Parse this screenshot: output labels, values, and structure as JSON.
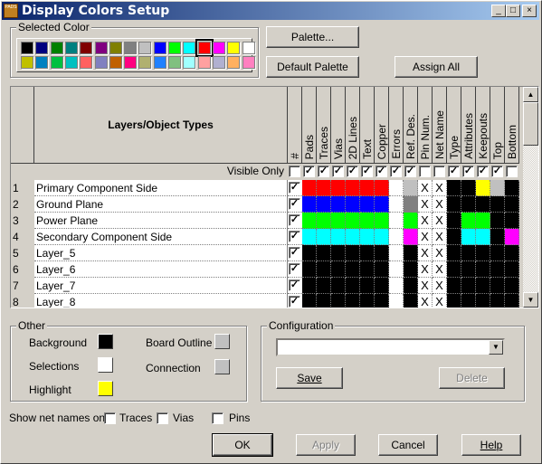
{
  "window": {
    "title": "Display Colors Setup",
    "app_icon_text": "PADS",
    "controls": [
      "_",
      "□",
      "×"
    ]
  },
  "selected_color": {
    "label": "Selected Color",
    "selected_index": 12,
    "palette": [
      "#000000",
      "#000080",
      "#008000",
      "#008080",
      "#800000",
      "#800080",
      "#808000",
      "#808080",
      "#c0c0c0",
      "#0000ff",
      "#00ff00",
      "#00ffff",
      "#ff0000",
      "#ff00ff",
      "#ffff00",
      "#ffffff",
      "#c0c000",
      "#0080c0",
      "#00c040",
      "#00c0c0",
      "#ff6060",
      "#8080c0",
      "#c06000",
      "#ff0080",
      "#b0b070",
      "#2080ff",
      "#80c080",
      "#a0ffff",
      "#ffa0a0",
      "#b0b0d0",
      "#ffb060",
      "#ff80c0"
    ]
  },
  "buttons": {
    "palette": "Palette...",
    "default_palette": "Default Palette",
    "assign_all": "Assign All",
    "save": "Save",
    "delete": "Delete",
    "ok": "OK",
    "apply": "Apply",
    "cancel": "Cancel",
    "help": "Help"
  },
  "table": {
    "header": "Layers/Object Types",
    "hash": "#",
    "visible_only": "Visible Only",
    "columns": [
      "Pads",
      "Traces",
      "Vias",
      "2D Lines",
      "Text",
      "Copper",
      "Errors",
      "Ref. Des.",
      "Pin Num.",
      "Net Name",
      "Type",
      "Attributes",
      "Keepouts",
      "Top",
      "Bottom"
    ],
    "visible_only_checks": [
      false,
      true,
      true,
      true,
      true,
      true,
      true,
      true,
      true,
      false,
      false,
      true,
      true,
      true,
      true,
      false
    ],
    "rows": [
      {
        "num": "1",
        "name": "Primary Component Side",
        "checked": true,
        "cells": [
          "#ff0000",
          "#ff0000",
          "#ff0000",
          "#ff0000",
          "#ff0000",
          "#ff0000",
          "#ffffff",
          "#c0c0c0",
          "X",
          "X",
          "#000000",
          "#000000",
          "#ffff00",
          "#c0c0c0",
          "#000000"
        ]
      },
      {
        "num": "2",
        "name": "Ground Plane",
        "checked": true,
        "cells": [
          "#0000ff",
          "#0000ff",
          "#0000ff",
          "#0000ff",
          "#0000ff",
          "#0000ff",
          "#ffffff",
          "#808080",
          "X",
          "X",
          "#000000",
          "#000000",
          "#000000",
          "#000000",
          "#000000"
        ]
      },
      {
        "num": "3",
        "name": "Power Plane",
        "checked": true,
        "cells": [
          "#00ff00",
          "#00ff00",
          "#00ff00",
          "#00ff00",
          "#00ff00",
          "#00ff00",
          "#ffffff",
          "#00ff00",
          "X",
          "X",
          "#000000",
          "#00ff00",
          "#00ff00",
          "#000000",
          "#000000"
        ]
      },
      {
        "num": "4",
        "name": "Secondary Component Side",
        "checked": true,
        "cells": [
          "#00ffff",
          "#00ffff",
          "#00ffff",
          "#00ffff",
          "#00ffff",
          "#00ffff",
          "#ffffff",
          "#ff00ff",
          "X",
          "X",
          "#000000",
          "#00ffff",
          "#00ffff",
          "#000000",
          "#ff00ff"
        ]
      },
      {
        "num": "5",
        "name": "Layer_5",
        "checked": true,
        "cells": [
          "#000000",
          "#000000",
          "#000000",
          "#000000",
          "#000000",
          "#000000",
          "#ffffff",
          "#000000",
          "X",
          "X",
          "#000000",
          "#000000",
          "#000000",
          "#000000",
          "#000000"
        ]
      },
      {
        "num": "6",
        "name": "Layer_6",
        "checked": true,
        "cells": [
          "#000000",
          "#000000",
          "#000000",
          "#000000",
          "#000000",
          "#000000",
          "#ffffff",
          "#000000",
          "X",
          "X",
          "#000000",
          "#000000",
          "#000000",
          "#000000",
          "#000000"
        ]
      },
      {
        "num": "7",
        "name": "Layer_7",
        "checked": true,
        "cells": [
          "#000000",
          "#000000",
          "#000000",
          "#000000",
          "#000000",
          "#000000",
          "#ffffff",
          "#000000",
          "X",
          "X",
          "#000000",
          "#000000",
          "#000000",
          "#000000",
          "#000000"
        ]
      },
      {
        "num": "8",
        "name": "Layer_8",
        "checked": true,
        "cells": [
          "#000000",
          "#000000",
          "#000000",
          "#000000",
          "#000000",
          "#000000",
          "#ffffff",
          "#000000",
          "X",
          "X",
          "#000000",
          "#000000",
          "#000000",
          "#000000",
          "#000000"
        ]
      }
    ]
  },
  "other": {
    "label": "Other",
    "background": "Background",
    "background_color": "#000000",
    "selections": "Selections",
    "selections_color": "#ffffff",
    "highlight": "Highlight",
    "highlight_color": "#ffff00",
    "board_outline": "Board Outline",
    "board_outline_color": "#c0c0c0",
    "connection": "Connection",
    "connection_color": "#c0c0c0"
  },
  "configuration": {
    "label": "Configuration",
    "value": ""
  },
  "net_names": {
    "label": "Show net names on",
    "traces": "Traces",
    "vias": "Vias",
    "pins": "Pins",
    "traces_checked": false,
    "vias_checked": false,
    "pins_checked": false
  }
}
